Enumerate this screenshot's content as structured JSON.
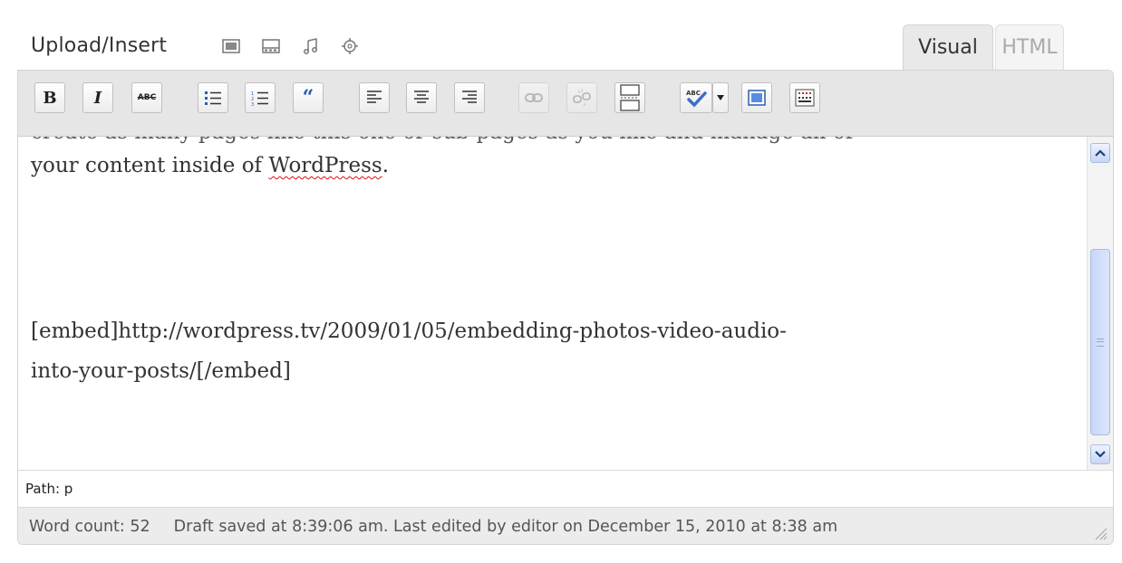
{
  "media_bar": {
    "upload_label": "Upload/Insert",
    "icons": [
      "image-icon",
      "video-icon",
      "audio-icon",
      "media-icon"
    ]
  },
  "tabs": {
    "visual": "Visual",
    "html": "HTML",
    "active": "Visual"
  },
  "toolbar": {
    "bold": "B",
    "italic": "I",
    "strikethrough": "ABC",
    "blockquote": "“",
    "buttons": [
      "bold",
      "italic",
      "strikethrough",
      "bulleted-list",
      "numbered-list",
      "blockquote",
      "align-left",
      "align-center",
      "align-right",
      "insert-link",
      "unlink",
      "insert-more-tag",
      "spellcheck",
      "spellcheck-dropdown",
      "fullscreen",
      "show-kitchen-sink"
    ]
  },
  "content": {
    "cut_line": "create as many pages like this one or sub-pages as you like and manage all of",
    "line2_start": "your content inside of ",
    "misspelled": "WordPress",
    "line2_end": ".",
    "embed_line1": "[embed]http://wordpress.tv/2009/01/05/embedding-photos-video-audio-",
    "embed_line2": "into-your-posts/[/embed]"
  },
  "path": {
    "text": "Path: p"
  },
  "status": {
    "word_count": "Word count: 52",
    "draft_saved": "Draft saved at 8:39:06 am. Last edited by editor on December 15, 2010 at 8:38 am"
  },
  "colors": {
    "accent": "#2a5db0",
    "toolbar_bg": "#e6e6e6",
    "scroll_thumb": "#c8d7f8"
  }
}
